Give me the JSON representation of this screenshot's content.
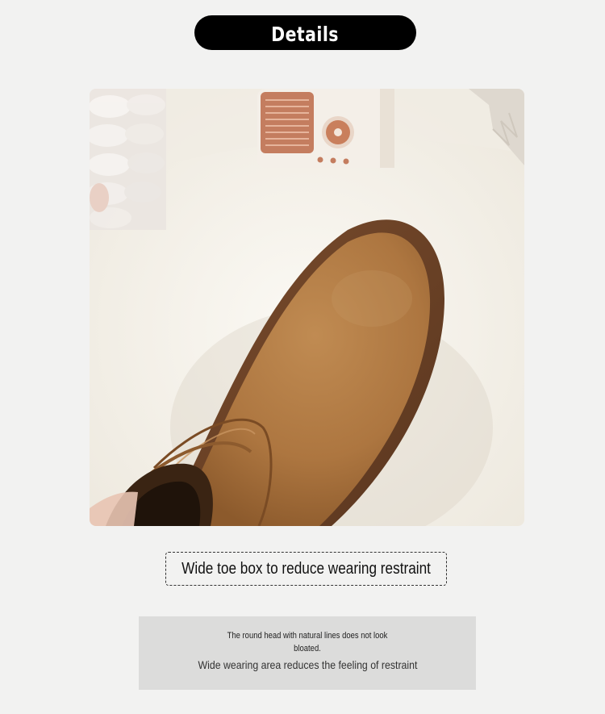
{
  "header": {
    "title": "Details"
  },
  "photo": {
    "subject": "boot-toe-closeup"
  },
  "feature": {
    "caption": "Wide toe box to reduce wearing restraint"
  },
  "description": {
    "line1": "The round head with natural lines does not look",
    "line2": "bloated.",
    "line3": "Wide wearing area reduces the feeling of restraint"
  },
  "colors": {
    "background": "#f2f2f1",
    "pill": "#000000",
    "suede": "#b07a43",
    "sole": "#6e4429",
    "panel": "#dcdcdb"
  }
}
